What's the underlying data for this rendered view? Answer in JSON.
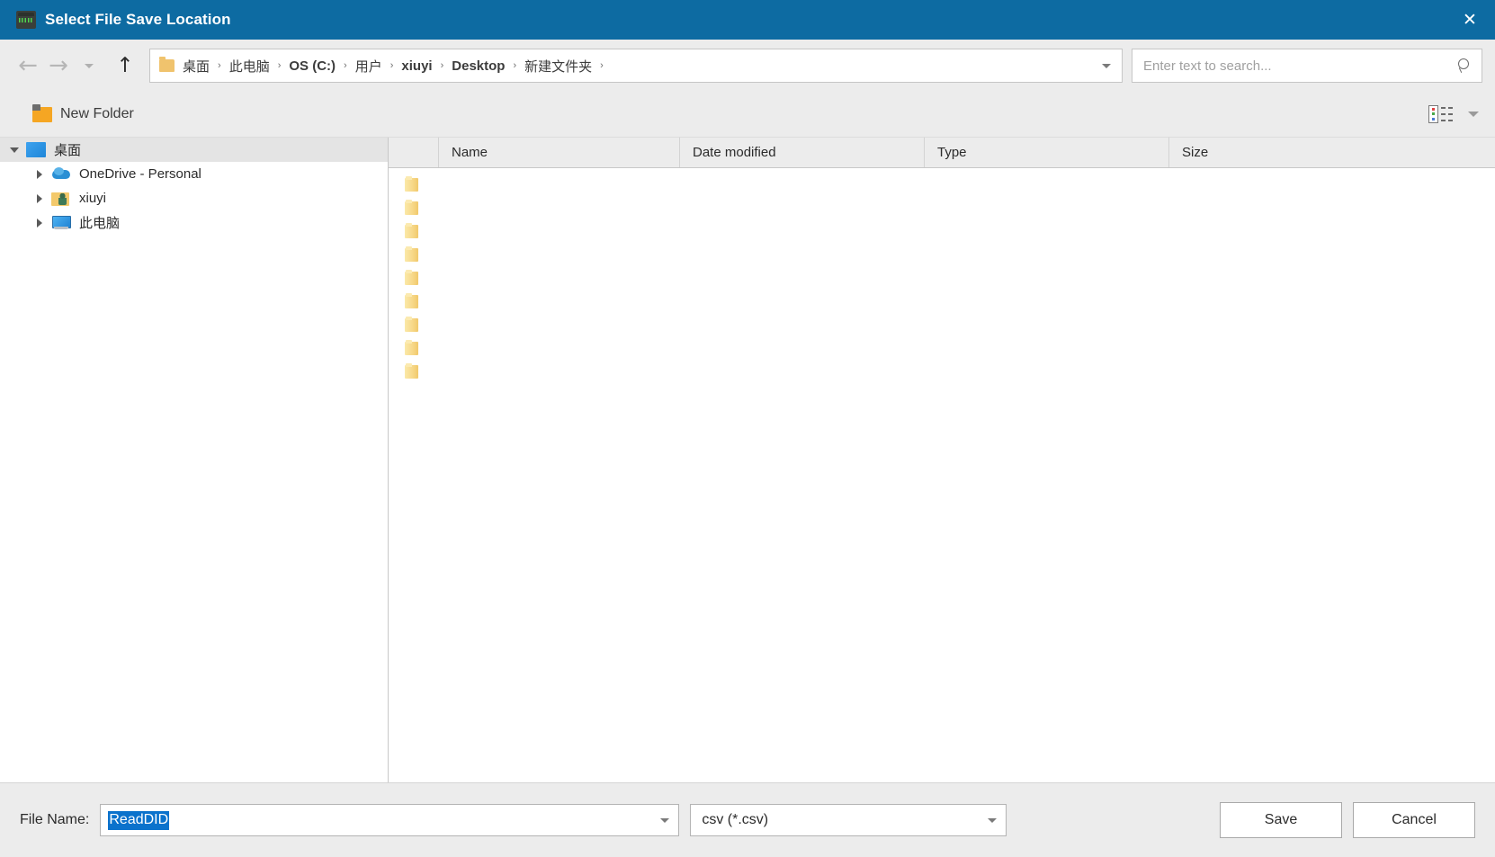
{
  "window": {
    "title": "Select File Save Location",
    "icon": "waveform-app-icon",
    "close_label": "✕",
    "title_bar_color": "#0d6ba2"
  },
  "nav": {
    "back": "←",
    "forward": "→",
    "recent_caret": "recent-locations-caret",
    "up": "↑"
  },
  "address": {
    "folder_icon": "folder-icon",
    "crumbs": [
      {
        "label": "桌面",
        "bold": false
      },
      {
        "label": "此电脑",
        "bold": false
      },
      {
        "label": "OS (C:)",
        "bold": true
      },
      {
        "label": "用户",
        "bold": false
      },
      {
        "label": "xiuyi",
        "bold": true
      },
      {
        "label": "Desktop",
        "bold": true
      },
      {
        "label": "新建文件夹",
        "bold": false
      }
    ],
    "separator": "›"
  },
  "search": {
    "value": "",
    "placeholder": "Enter text to search..."
  },
  "toolbar": {
    "new_folder_label": "New Folder",
    "view_mode": "details-view",
    "view_caret": "view-options-caret"
  },
  "sidebar": {
    "items": [
      {
        "label": "桌面",
        "icon": "desktop-icon",
        "expanded": true,
        "selected": true,
        "indent": false
      },
      {
        "label": "OneDrive - Personal",
        "icon": "onedrive-cloud-icon",
        "expanded": false,
        "selected": false,
        "indent": true
      },
      {
        "label": "xiuyi",
        "icon": "user-folder-icon",
        "expanded": false,
        "selected": false,
        "indent": true
      },
      {
        "label": "此电脑",
        "icon": "this-pc-icon",
        "expanded": false,
        "selected": false,
        "indent": true
      }
    ]
  },
  "filelist": {
    "columns": [
      {
        "key": "name",
        "label": "Name"
      },
      {
        "key": "date",
        "label": "Date modified"
      },
      {
        "key": "type",
        "label": "Type"
      },
      {
        "key": "size",
        "label": "Size"
      }
    ],
    "rows": [
      {
        "icon": "folder-icon",
        "name": "",
        "date": "",
        "type": "",
        "size": ""
      },
      {
        "icon": "folder-icon",
        "name": "",
        "date": "",
        "type": "",
        "size": ""
      },
      {
        "icon": "folder-icon",
        "name": "",
        "date": "",
        "type": "",
        "size": ""
      },
      {
        "icon": "folder-icon",
        "name": "",
        "date": "",
        "type": "",
        "size": ""
      },
      {
        "icon": "folder-icon",
        "name": "",
        "date": "",
        "type": "",
        "size": ""
      },
      {
        "icon": "folder-icon",
        "name": "",
        "date": "",
        "type": "",
        "size": ""
      },
      {
        "icon": "folder-icon",
        "name": "",
        "date": "",
        "type": "",
        "size": ""
      },
      {
        "icon": "folder-icon",
        "name": "",
        "date": "",
        "type": "",
        "size": ""
      },
      {
        "icon": "folder-icon",
        "name": "",
        "date": "",
        "type": "",
        "size": ""
      }
    ]
  },
  "footer": {
    "file_name_label": "File Name:",
    "file_name_value": "ReadDID",
    "file_type_value": "csv (*.csv)",
    "save_label": "Save",
    "cancel_label": "Cancel",
    "selection_color": "#0b72cc"
  }
}
